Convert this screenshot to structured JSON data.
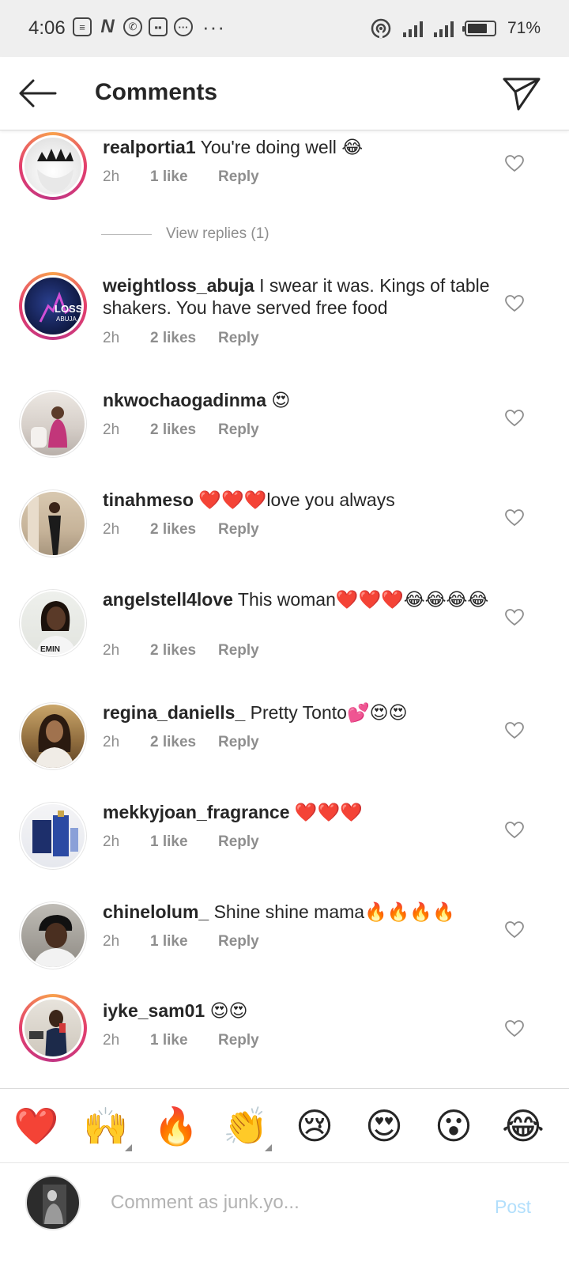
{
  "status_bar": {
    "time": "4:06",
    "battery": "71%",
    "left_icons": [
      "notes-icon",
      "n-app-icon",
      "whatsapp-icon",
      "game-icon",
      "chat-bubble-icon"
    ],
    "overflow": "···"
  },
  "header": {
    "title": "Comments"
  },
  "comments": [
    {
      "user": "realportia1",
      "text": " You're doing well 😂",
      "time": "2h",
      "likes": "1 like",
      "reply": "Reply",
      "has_story_ring": true,
      "view_replies": "View replies (1)"
    },
    {
      "user": "weightloss_abuja",
      "text": " I swear it was. Kings of table shakers. You have served free food",
      "time": "2h",
      "likes": "2 likes",
      "reply": "Reply",
      "has_story_ring": true
    },
    {
      "user": "nkwochaogadinma",
      "text": " 😍",
      "time": "2h",
      "likes": "2 likes",
      "reply": "Reply",
      "has_story_ring": false
    },
    {
      "user": "tinahmeso",
      "text": " ❤️❤️❤️love you always",
      "time": "2h",
      "likes": "2 likes",
      "reply": "Reply",
      "has_story_ring": false
    },
    {
      "user": "angelstell4love",
      "text": " This woman❤️❤️❤️😂😂😂😂",
      "time": "2h",
      "likes": "2 likes",
      "reply": "Reply",
      "has_story_ring": false
    },
    {
      "user": "regina_daniells_",
      "text": " Pretty Tonto💕😍😍",
      "time": "2h",
      "likes": "2 likes",
      "reply": "Reply",
      "has_story_ring": false
    },
    {
      "user": "mekkyjoan_fragrance",
      "text": " ❤️❤️❤️",
      "time": "2h",
      "likes": "1 like",
      "reply": "Reply",
      "has_story_ring": false
    },
    {
      "user": "chinelolum_",
      "text": " Shine shine mama🔥🔥🔥🔥",
      "time": "2h",
      "likes": "1 like",
      "reply": "Reply",
      "has_story_ring": false
    },
    {
      "user": "iyke_sam01",
      "text": " 😍😍",
      "time": "2h",
      "likes": "1 like",
      "reply": "Reply",
      "has_story_ring": true
    }
  ],
  "reactions": [
    "❤️",
    "🙌",
    "🔥",
    "👏",
    "😢",
    "😍",
    "😮",
    "😂"
  ],
  "composer": {
    "placeholder": "Comment as junk.yo...",
    "post_label": "Post"
  },
  "colors": {
    "text": "#262626",
    "secondary": "#8e8e8e",
    "post_disabled": "#b2dffc",
    "story_ring_start": "#f8a14d",
    "story_ring_end": "#c13584"
  }
}
